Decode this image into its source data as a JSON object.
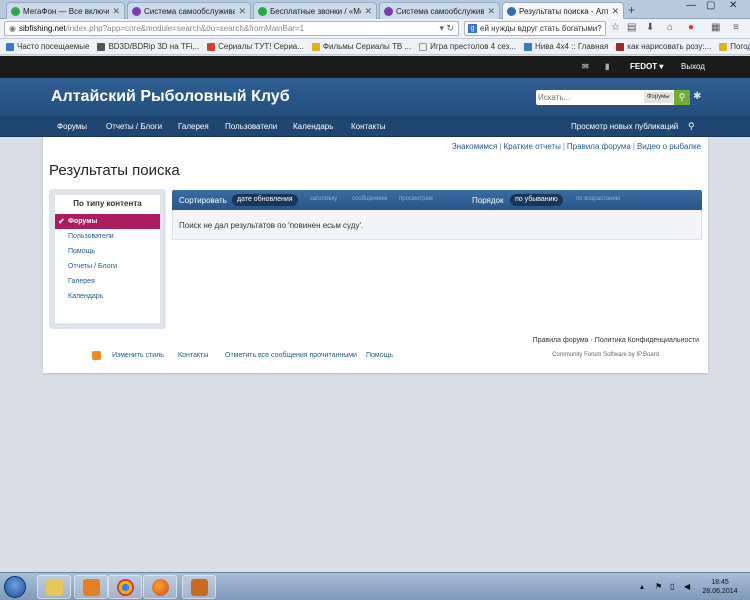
{
  "browser": {
    "tabs": [
      {
        "title": "МегаФон — Все включен...",
        "color": "#2aa84a",
        "active": false
      },
      {
        "title": "Система самообслужива...",
        "color": "#7a3db0",
        "active": false
      },
      {
        "title": "Бесплатные звонки / «Ме...",
        "color": "#2aa84a",
        "active": false
      },
      {
        "title": "Система самообслужива...",
        "color": "#7a3db0",
        "active": false
      },
      {
        "title": "Результаты поиска - Алта...",
        "color": "#2f6fb6",
        "active": true
      }
    ],
    "new_tab": "+",
    "url_host": "sibfishing.net",
    "url_rest": "/index.php?app=core&module=search&do=search&fromMainBar=1",
    "search_text": "ей нужды вдруг стать богатыми?",
    "bookmarks": [
      {
        "label": "Часто посещаемые",
        "color": "#3a78c9"
      },
      {
        "label": "BD3D/BDRip 3D на TFi...",
        "color": "#555"
      },
      {
        "label": "Сериалы ТУТ! Сериа...",
        "color": "#d4402e"
      },
      {
        "label": "Фильмы Сериалы ТВ ...",
        "color": "#e0b020"
      },
      {
        "label": "Игра престолов 4 сез...",
        "color": "#eeeeee"
      },
      {
        "label": "Нива 4x4 :: Главная",
        "color": "#3a78c9"
      },
      {
        "label": "как нарисовать розу:...",
        "color": "#9a2a2a"
      },
      {
        "label": "Погода в Новоалтайс...",
        "color": "#e0b020"
      }
    ]
  },
  "site": {
    "user": {
      "name": "FEDOT",
      "logout": "Выход"
    },
    "logo": "Алтайский Рыболовный Клуб",
    "search_placeholder": "Искать...",
    "search_scope": "Форумы",
    "nav": [
      "Форумы",
      "Отчеты / Блоги",
      "Галерея",
      "Пользователи",
      "Календарь",
      "Контакты"
    ],
    "nav_right": "Просмотр новых публикаций",
    "top_links": [
      "Знакомимся",
      "Краткие отчеты",
      "Правила форума",
      "Видео о рыбалке"
    ],
    "page_title": "Результаты поиска",
    "sidebar": {
      "heading": "По типу контента",
      "items": [
        "Форумы",
        "Пользователи",
        "Помощь",
        "Отчеты / Блоги",
        "Галерея",
        "Календарь"
      ]
    },
    "sort": {
      "label": "Сортировать",
      "active": "дате обновления",
      "options": [
        "заголовку",
        "сообщениям",
        "просмотрам"
      ],
      "order_label": "Порядок",
      "order_active": "по убыванию",
      "order_option": "по возрастанию"
    },
    "result_message": "Поиск не дал результатов по 'повинен есьм суду'.",
    "footer": {
      "links_right": "Правила форума · Политика Конфиденциальности",
      "links": [
        "Изменить стиль",
        "Контакты",
        "Отметить все сообщения прочитанными",
        "Помощь"
      ],
      "powered": "Community Forum Software by IP.Board"
    }
  },
  "taskbar": {
    "time": "18:45",
    "date": "28.06.2014"
  }
}
